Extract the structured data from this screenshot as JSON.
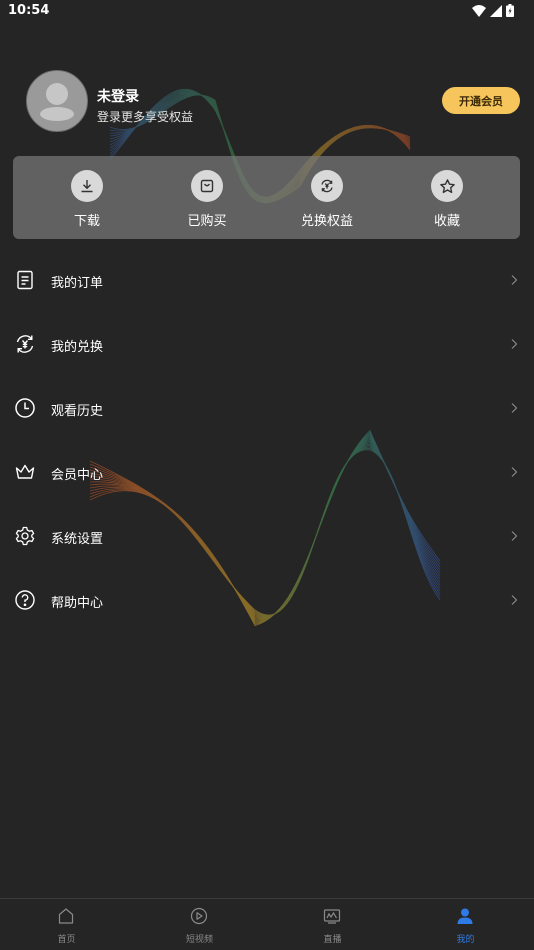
{
  "status_bar": {
    "time": "10:54"
  },
  "profile": {
    "name": "未登录",
    "subtitle": "登录更多享受权益",
    "vip_button": "开通会员"
  },
  "quick_actions": [
    {
      "label": "下载",
      "icon": "download-icon"
    },
    {
      "label": "已购买",
      "icon": "bag-icon"
    },
    {
      "label": "兑换权益",
      "icon": "exchange-icon"
    },
    {
      "label": "收藏",
      "icon": "star-icon"
    }
  ],
  "menu": [
    {
      "label": "我的订单",
      "icon": "order-icon"
    },
    {
      "label": "我的兑换",
      "icon": "redeem-icon"
    },
    {
      "label": "观看历史",
      "icon": "clock-icon"
    },
    {
      "label": "会员中心",
      "icon": "crown-icon"
    },
    {
      "label": "系统设置",
      "icon": "gear-icon"
    },
    {
      "label": "帮助中心",
      "icon": "help-icon"
    }
  ],
  "tabs": [
    {
      "label": "首页",
      "icon": "home-icon",
      "active": false
    },
    {
      "label": "短视频",
      "icon": "play-icon",
      "active": false
    },
    {
      "label": "直播",
      "icon": "live-icon",
      "active": false
    },
    {
      "label": "我的",
      "icon": "user-icon",
      "active": true
    }
  ],
  "colors": {
    "background": "#252525",
    "accent": "#f6c65c",
    "tab_active": "#2f7be5"
  }
}
